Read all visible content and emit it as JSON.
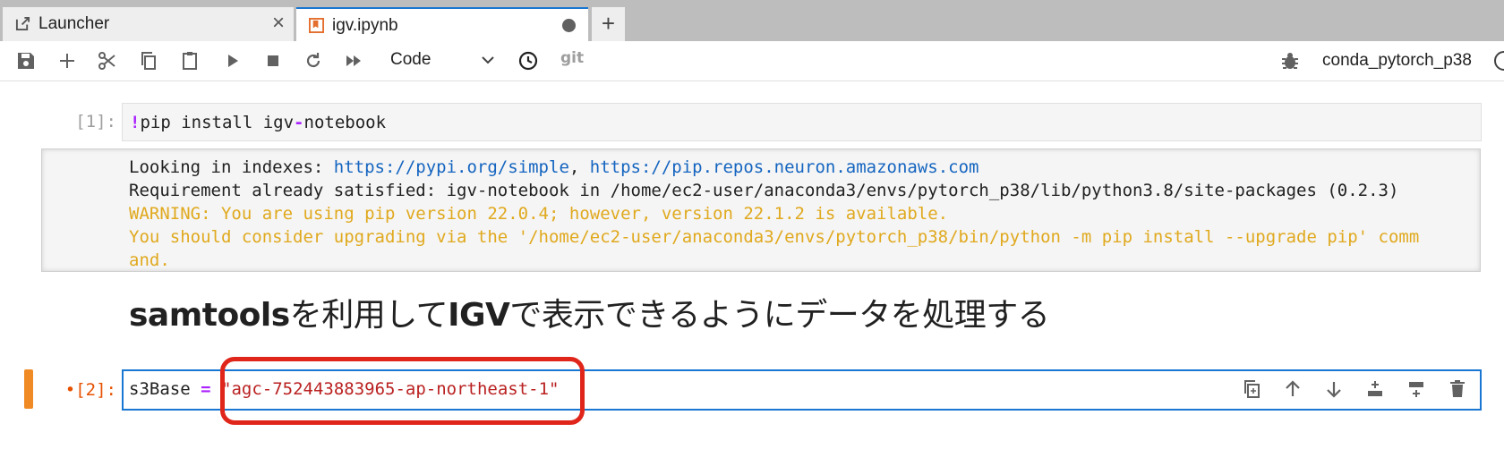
{
  "tabs": [
    {
      "label": "Launcher",
      "active": false
    },
    {
      "label": "igv.ipynb",
      "active": true
    }
  ],
  "toolbar": {
    "cell_type": "Code",
    "git_label": "git",
    "kernel_name": "conda_pytorch_p38",
    "icons": [
      "save-icon",
      "add-icon",
      "cut-icon",
      "copy-icon",
      "paste-icon",
      "run-icon",
      "stop-icon",
      "restart-icon",
      "fast-forward-icon",
      "clock-icon",
      "git-icon",
      "bug-icon",
      "kernel-status-icon"
    ]
  },
  "cells": {
    "cell1": {
      "prompt": "[1]:",
      "code_op": "!",
      "code_a": "pip install igv",
      "code_op2": "-",
      "code_b": "notebook",
      "output": {
        "line1_prefix": "Looking in indexes: ",
        "line1_link1": "https://pypi.org/simple",
        "line1_sep": ", ",
        "line1_link2": "https://pip.repos.neuron.amazonaws.com",
        "line2": "Requirement already satisfied: igv-notebook in /home/ec2-user/anaconda3/envs/pytorch_p38/lib/python3.8/site-packages (0.2.3)",
        "line3": "WARNING: You are using pip version 22.0.4; however, version 22.1.2 is available.",
        "line4": "You should consider upgrading via the '/home/ec2-user/anaconda3/envs/pytorch_p38/bin/python -m pip install --upgrade pip' comm",
        "line5": "and."
      }
    },
    "markdown": {
      "heading_a": "samtools",
      "heading_b": "を利用して",
      "heading_c": "IGV",
      "heading_d": "で表示できるようにデータを処理する"
    },
    "cell2": {
      "prompt_dot": "•",
      "prompt": "[2]:",
      "var": "s3Base",
      "op": "=",
      "value": "\"agc-752443883965-ap-northeast-1\"",
      "tool_icons": [
        "duplicate-icon",
        "move-up-icon",
        "move-down-icon",
        "insert-above-icon",
        "insert-below-icon",
        "delete-icon"
      ]
    }
  },
  "colors": {
    "accent": "#1976d2",
    "active_cell": "#f08a24",
    "highlight": "#e0261b",
    "warning_text": "#e0a91e",
    "link": "#1565c0",
    "string": "#ba2121",
    "operator": "#aa22ff"
  }
}
